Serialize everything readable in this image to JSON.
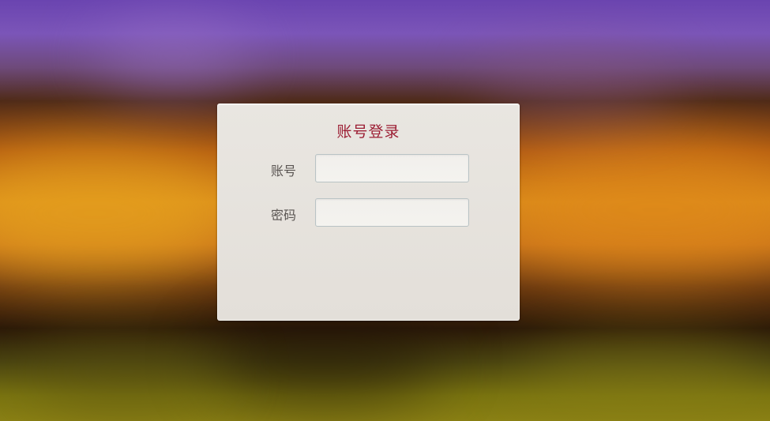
{
  "login": {
    "title": "账号登录",
    "account_label": "账号",
    "account_value": "",
    "account_placeholder": "",
    "password_label": "密码",
    "password_value": "",
    "password_placeholder": ""
  },
  "colors": {
    "title": "#9c1e34",
    "panel": "#e6e3de",
    "input_border": "#b9c3c5"
  }
}
